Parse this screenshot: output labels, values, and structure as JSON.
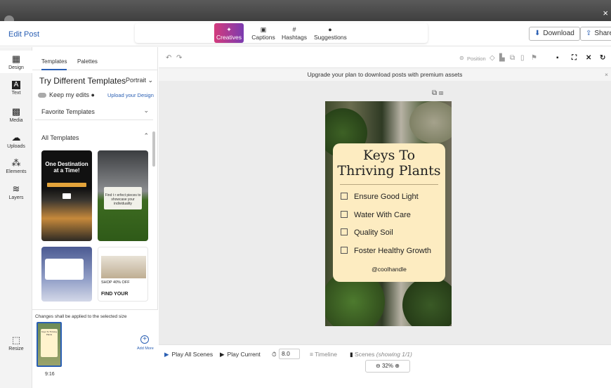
{
  "window": {
    "close_glyph": "×"
  },
  "header": {
    "edit_post": "Edit Post",
    "tabs": [
      {
        "label": "Creatives",
        "icon": "magic-wand-icon",
        "glyph": "✦"
      },
      {
        "label": "Captions",
        "icon": "cc-icon",
        "glyph": "▣"
      },
      {
        "label": "Hashtags",
        "icon": "hashtag-icon",
        "glyph": "#"
      },
      {
        "label": "Suggestions",
        "icon": "lightbulb-icon",
        "glyph": "●"
      }
    ],
    "download": "Download",
    "share": "Share"
  },
  "rail": [
    {
      "label": "Design",
      "glyph": "▦"
    },
    {
      "label": "Text",
      "glyph": "A"
    },
    {
      "label": "Media",
      "glyph": "▩"
    },
    {
      "label": "Uploads",
      "glyph": "☁"
    },
    {
      "label": "Elements",
      "glyph": "⁂"
    },
    {
      "label": "Layers",
      "glyph": "≋"
    },
    {
      "label": "Resize",
      "glyph": "⬚"
    }
  ],
  "panel": {
    "tabs": [
      "Templates",
      "Palettes"
    ],
    "title": "Try Different Templates",
    "orientation": "Portrait",
    "keep_edits": "Keep my edits",
    "upload_design": "Upload your Design",
    "favorite_templates": "Favorite Templates",
    "all_templates": "All Templates",
    "thumb1_heading": "One Destination at a Time!",
    "thumb2_text": "Find t  r  erfect pieces to showcase your individuality",
    "thumb4_text": "SHOP 40% OFF",
    "thumb4_find": "FIND YOUR",
    "size_note": "Changes shall be applied to the selected size",
    "size_thumb_text": "Keys To Thriving Plants",
    "size_label": "9:16",
    "add_more": "Add More"
  },
  "toolbar": {
    "position": "Position",
    "upgrade": "Upgrade your plan to download posts with premium assets"
  },
  "poster": {
    "title_line1": "Keys To",
    "title_line2": "Thriving Plants",
    "items": [
      "Ensure Good Light",
      "Water With Care",
      "Quality Soil",
      "Foster Healthy Growth"
    ],
    "handle": "@coolhandle",
    "card_color": "#fdecc1"
  },
  "bottom": {
    "play_all": "Play All Scenes",
    "play_current": "Play Current",
    "duration": "8.0",
    "timeline": "Timeline",
    "scenes": "Scenes",
    "scenes_note": "(showing 1/1)",
    "zoom": "32%"
  },
  "colors": {
    "accent": "#2a5fb3",
    "creatives_gradient_start": "#d43b7c",
    "creatives_gradient_end": "#7b3bb0"
  }
}
